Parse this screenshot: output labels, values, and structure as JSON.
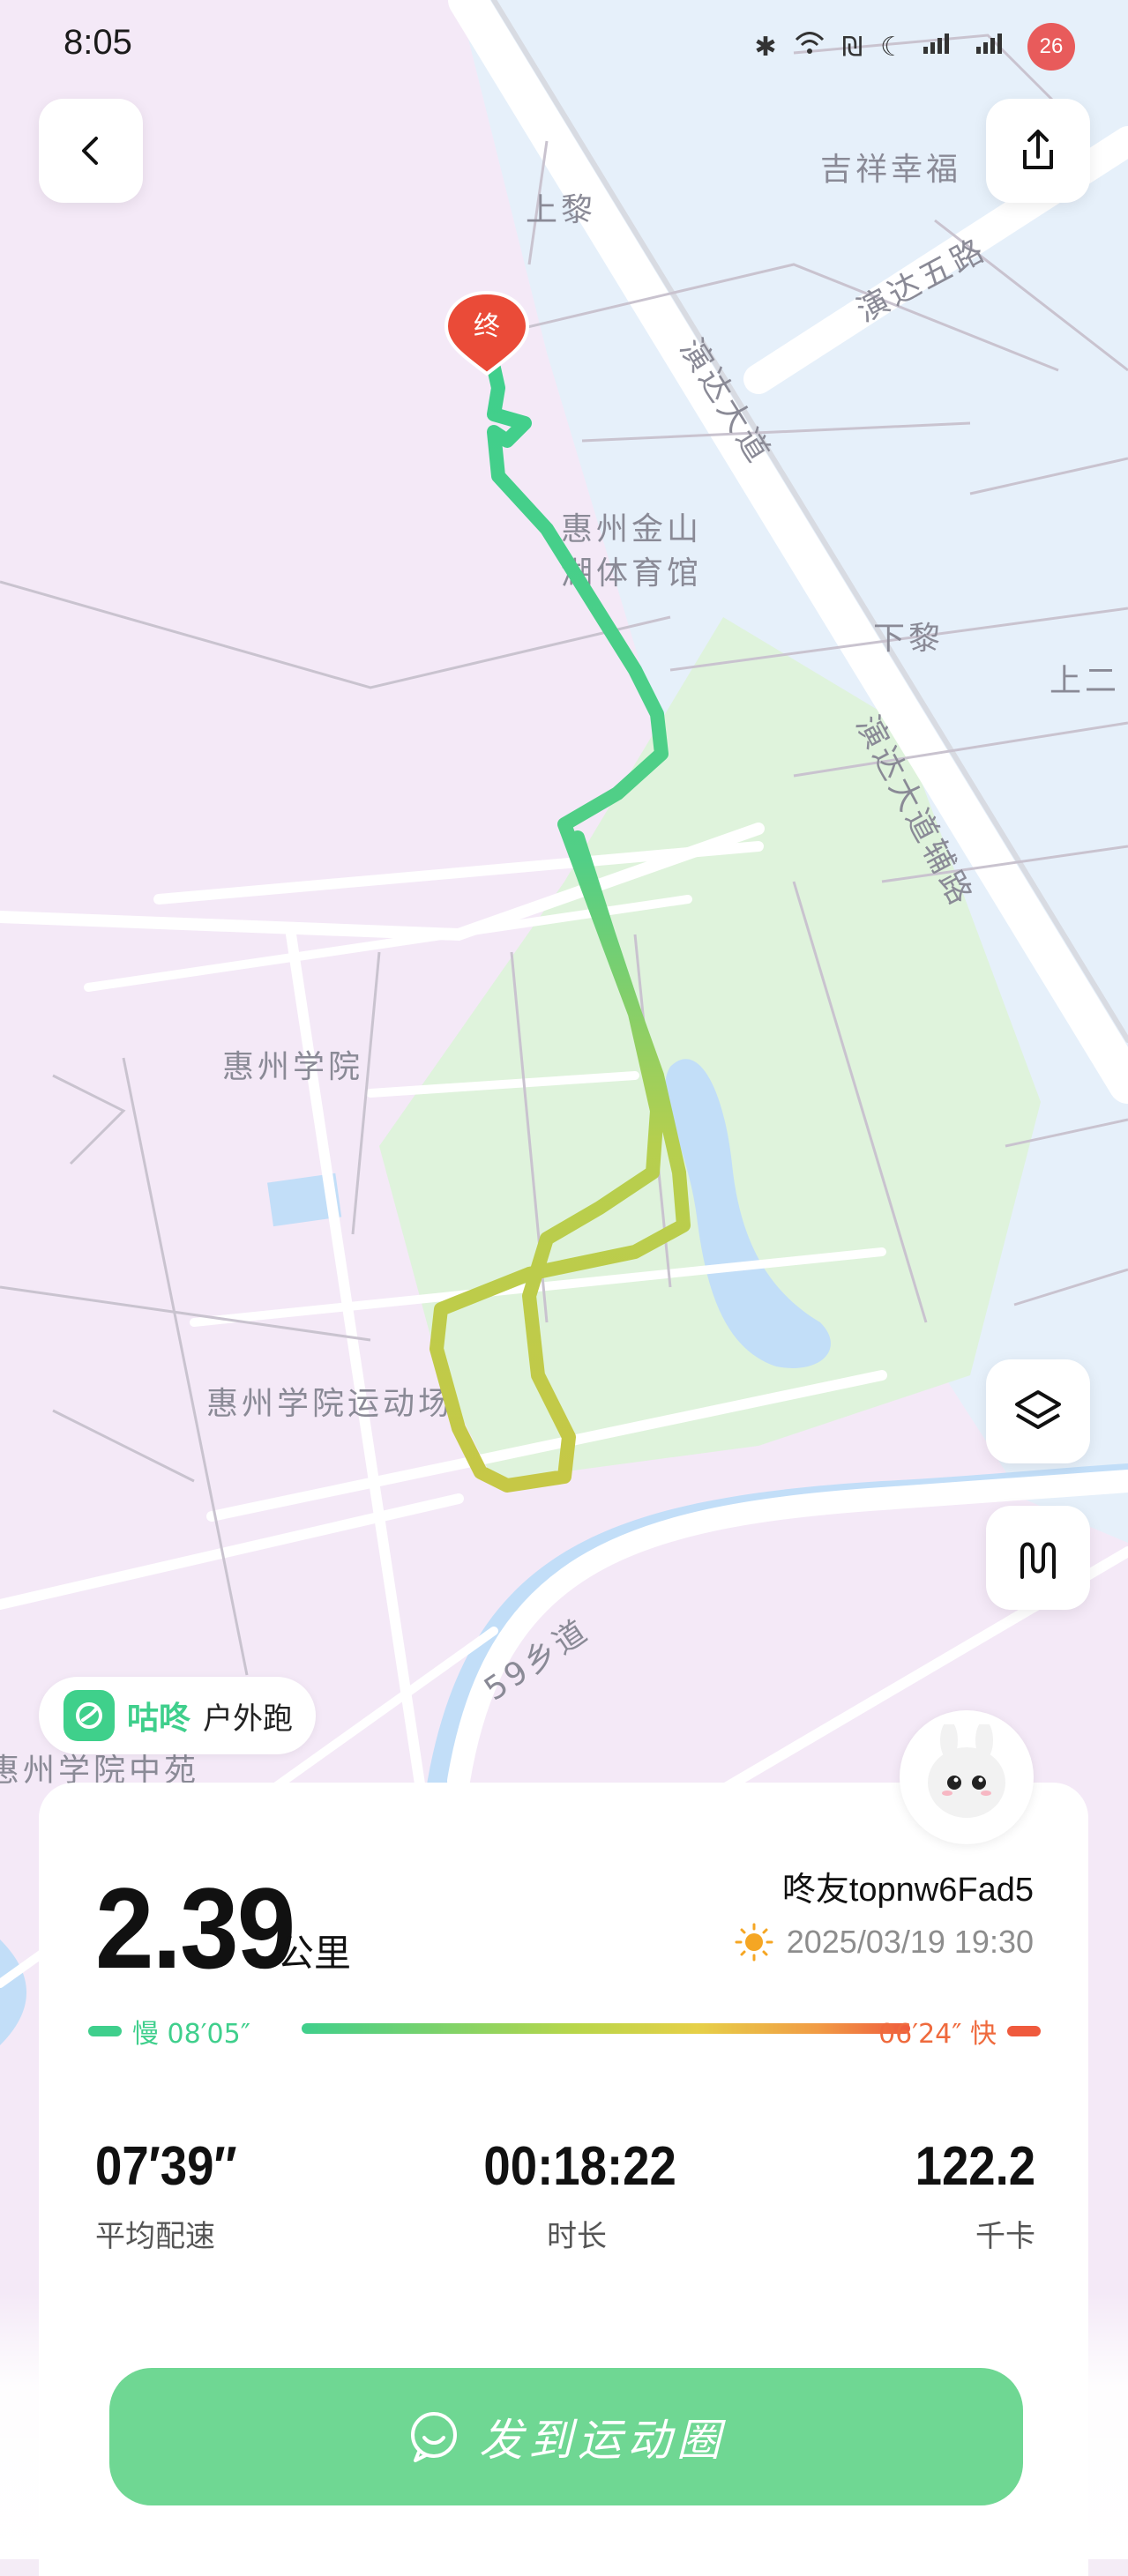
{
  "status_bar": {
    "time": "8:05",
    "battery": "26",
    "icons": [
      "bluetooth-icon",
      "wifi-icon",
      "nfc-icon",
      "moon-icon",
      "signal-5g-icon",
      "signal-5g-icon"
    ]
  },
  "map": {
    "labels": {
      "shangli": "上黎",
      "jixiang": "吉祥幸福",
      "yanda5": "演达五路",
      "yanda_avenue": "演达大道",
      "stadium1": "惠州金山",
      "stadium2": "湖体育馆",
      "xiali": "下黎",
      "shanger": "上二",
      "yanda_aux": "演达大道辅路",
      "college": "惠州学院",
      "sports_field": "惠州学院运动场",
      "road59": "59乡道",
      "college_school": "惠州学院中苑"
    },
    "end_marker": "终",
    "colors": {
      "land": "#f4ecf6",
      "green": "#dff1dc",
      "water": "#c2def8",
      "road": "#ffffff"
    }
  },
  "brand": {
    "name": "咕咚",
    "sport": "户外跑"
  },
  "summary": {
    "distance": "2.39",
    "distance_unit": "公里",
    "user": "咚友topnw6Fad5",
    "datetime": "2025/03/19 19:30",
    "weather_icon": "sun-icon",
    "pace_slow_label": "慢 08′05″",
    "pace_fast_label": "06′24″ 快",
    "stats": [
      {
        "value": "07′39″",
        "label": "平均配速"
      },
      {
        "value": "00:18:22",
        "label": "时长"
      },
      {
        "value": "122.2",
        "label": "千卡"
      }
    ]
  },
  "actions": {
    "share_label": "发到运动圈"
  },
  "accent": "#3fcf8c"
}
